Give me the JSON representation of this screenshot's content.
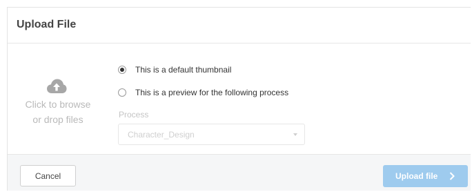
{
  "dialog": {
    "title": "Upload File"
  },
  "dropzone": {
    "icon": "cloud-upload-icon",
    "line1": "Click to browse",
    "line2": "or drop files"
  },
  "options": [
    {
      "label": "This is a default thumbnail",
      "checked": true
    },
    {
      "label": "This is a preview for the following process",
      "checked": false
    }
  ],
  "process": {
    "label": "Process",
    "selected": "Character_Design",
    "disabled": true
  },
  "footer": {
    "cancel_label": "Cancel",
    "upload_label": "Upload file",
    "upload_icon": "chevron-right-icon"
  },
  "colors": {
    "primary_disabled": "#9ecbee",
    "footer_bg": "#f5f6f7"
  }
}
